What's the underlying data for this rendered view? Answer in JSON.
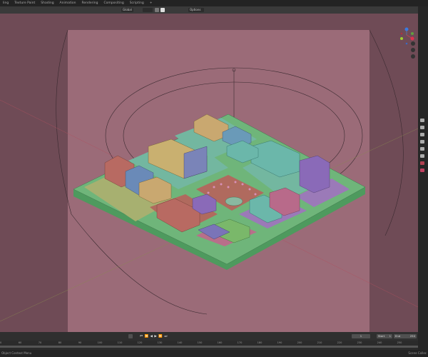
{
  "workspaces": [
    "ling",
    "Texture Paint",
    "Shading",
    "Animation",
    "Rendering",
    "Compositing",
    "Scripting",
    "+"
  ],
  "header": {
    "orientation": "Global",
    "options": "Options"
  },
  "timeline": {
    "current_frame": "1",
    "start_label": "Start",
    "start": "1",
    "end_label": "End",
    "end": "250",
    "ticks": [
      "50",
      "60",
      "70",
      "80",
      "90",
      "100",
      "110",
      "120",
      "130",
      "140",
      "150",
      "160",
      "170",
      "180",
      "190",
      "200",
      "210",
      "220",
      "230",
      "240",
      "250"
    ]
  },
  "status": {
    "left": "Object Context Menu",
    "right": "Scene Collec"
  },
  "colors": {
    "viewport": "#6f4b56",
    "camera_frame": "#9b6b78",
    "ground": "#6fb57a",
    "accent": "#4772b3"
  }
}
